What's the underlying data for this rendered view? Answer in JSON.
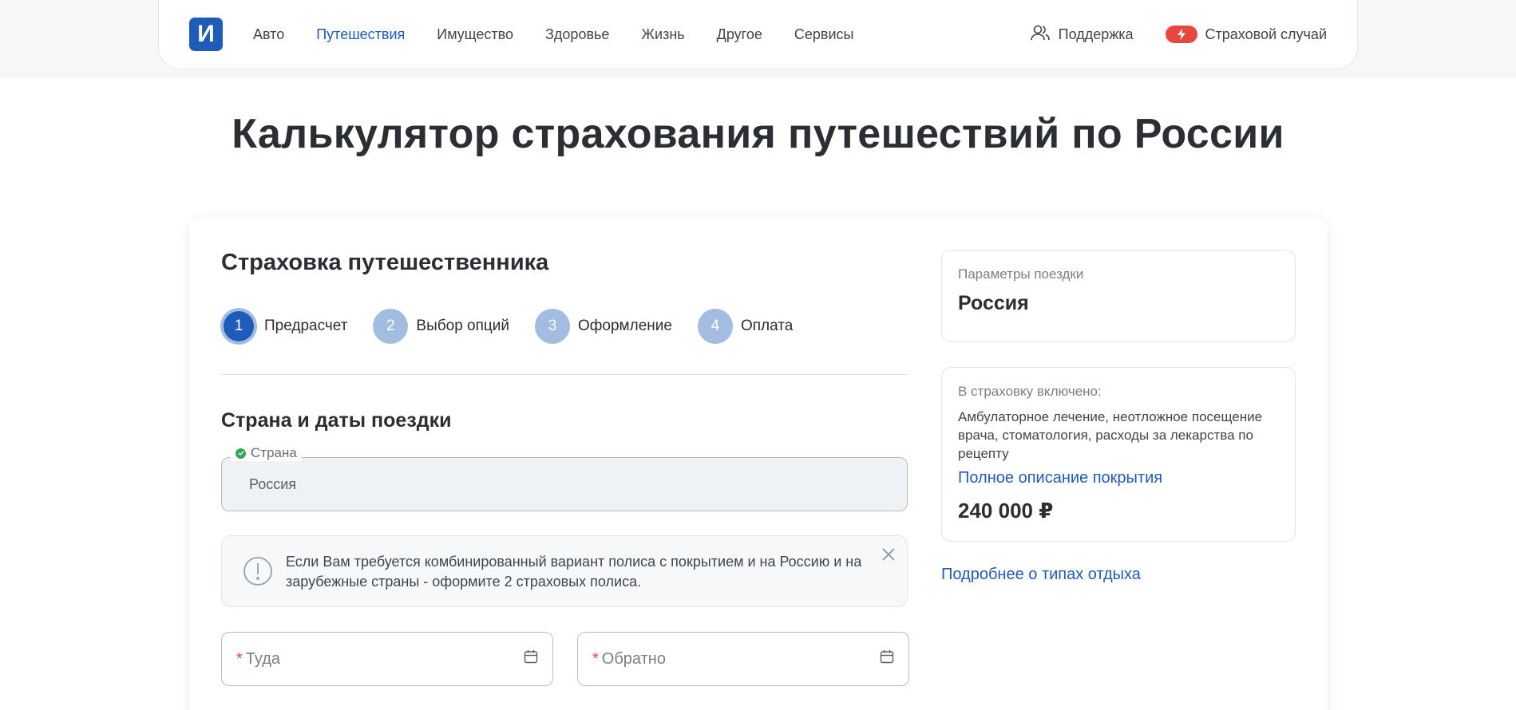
{
  "header": {
    "logo_letter": "И",
    "nav": [
      "Авто",
      "Путешествия",
      "Имущество",
      "Здоровье",
      "Жизнь",
      "Другое",
      "Сервисы"
    ],
    "support": "Поддержка",
    "claim": "Страховой случай"
  },
  "page_title": "Калькулятор страхования путешествий по России",
  "form": {
    "title": "Страховка путешественника",
    "steps": [
      {
        "num": "1",
        "label": "Предрасчет"
      },
      {
        "num": "2",
        "label": "Выбор опций"
      },
      {
        "num": "3",
        "label": "Оформление"
      },
      {
        "num": "4",
        "label": "Оплата"
      }
    ],
    "section_title": "Страна и даты поездки",
    "country_label": "Страна",
    "country_value": "Россия",
    "notice": "Если Вам требуется комбинированный вариант полиса с покрытием и на Россию и на зарубежные страны - оформите 2 страховых полиса.",
    "date_there": "Туда",
    "date_back": "Обратно",
    "required_mark": "*"
  },
  "sidebar": {
    "params_label": "Параметры поездки",
    "params_value": "Россия",
    "included_label": "В страховку включено:",
    "included_desc": "Амбулаторное лечение, неотложное посещение врача, стоматология, расходы за лекарства по рецепту",
    "coverage_link": "Полное описание покрытия",
    "sum": "240 000 ₽",
    "more_link": "Подробнее о типах отдыха"
  },
  "colors": {
    "brand": "#1f5bb8",
    "step_inactive": "#a3bde2",
    "alert": "#e8473f",
    "success": "#2fa85a"
  }
}
